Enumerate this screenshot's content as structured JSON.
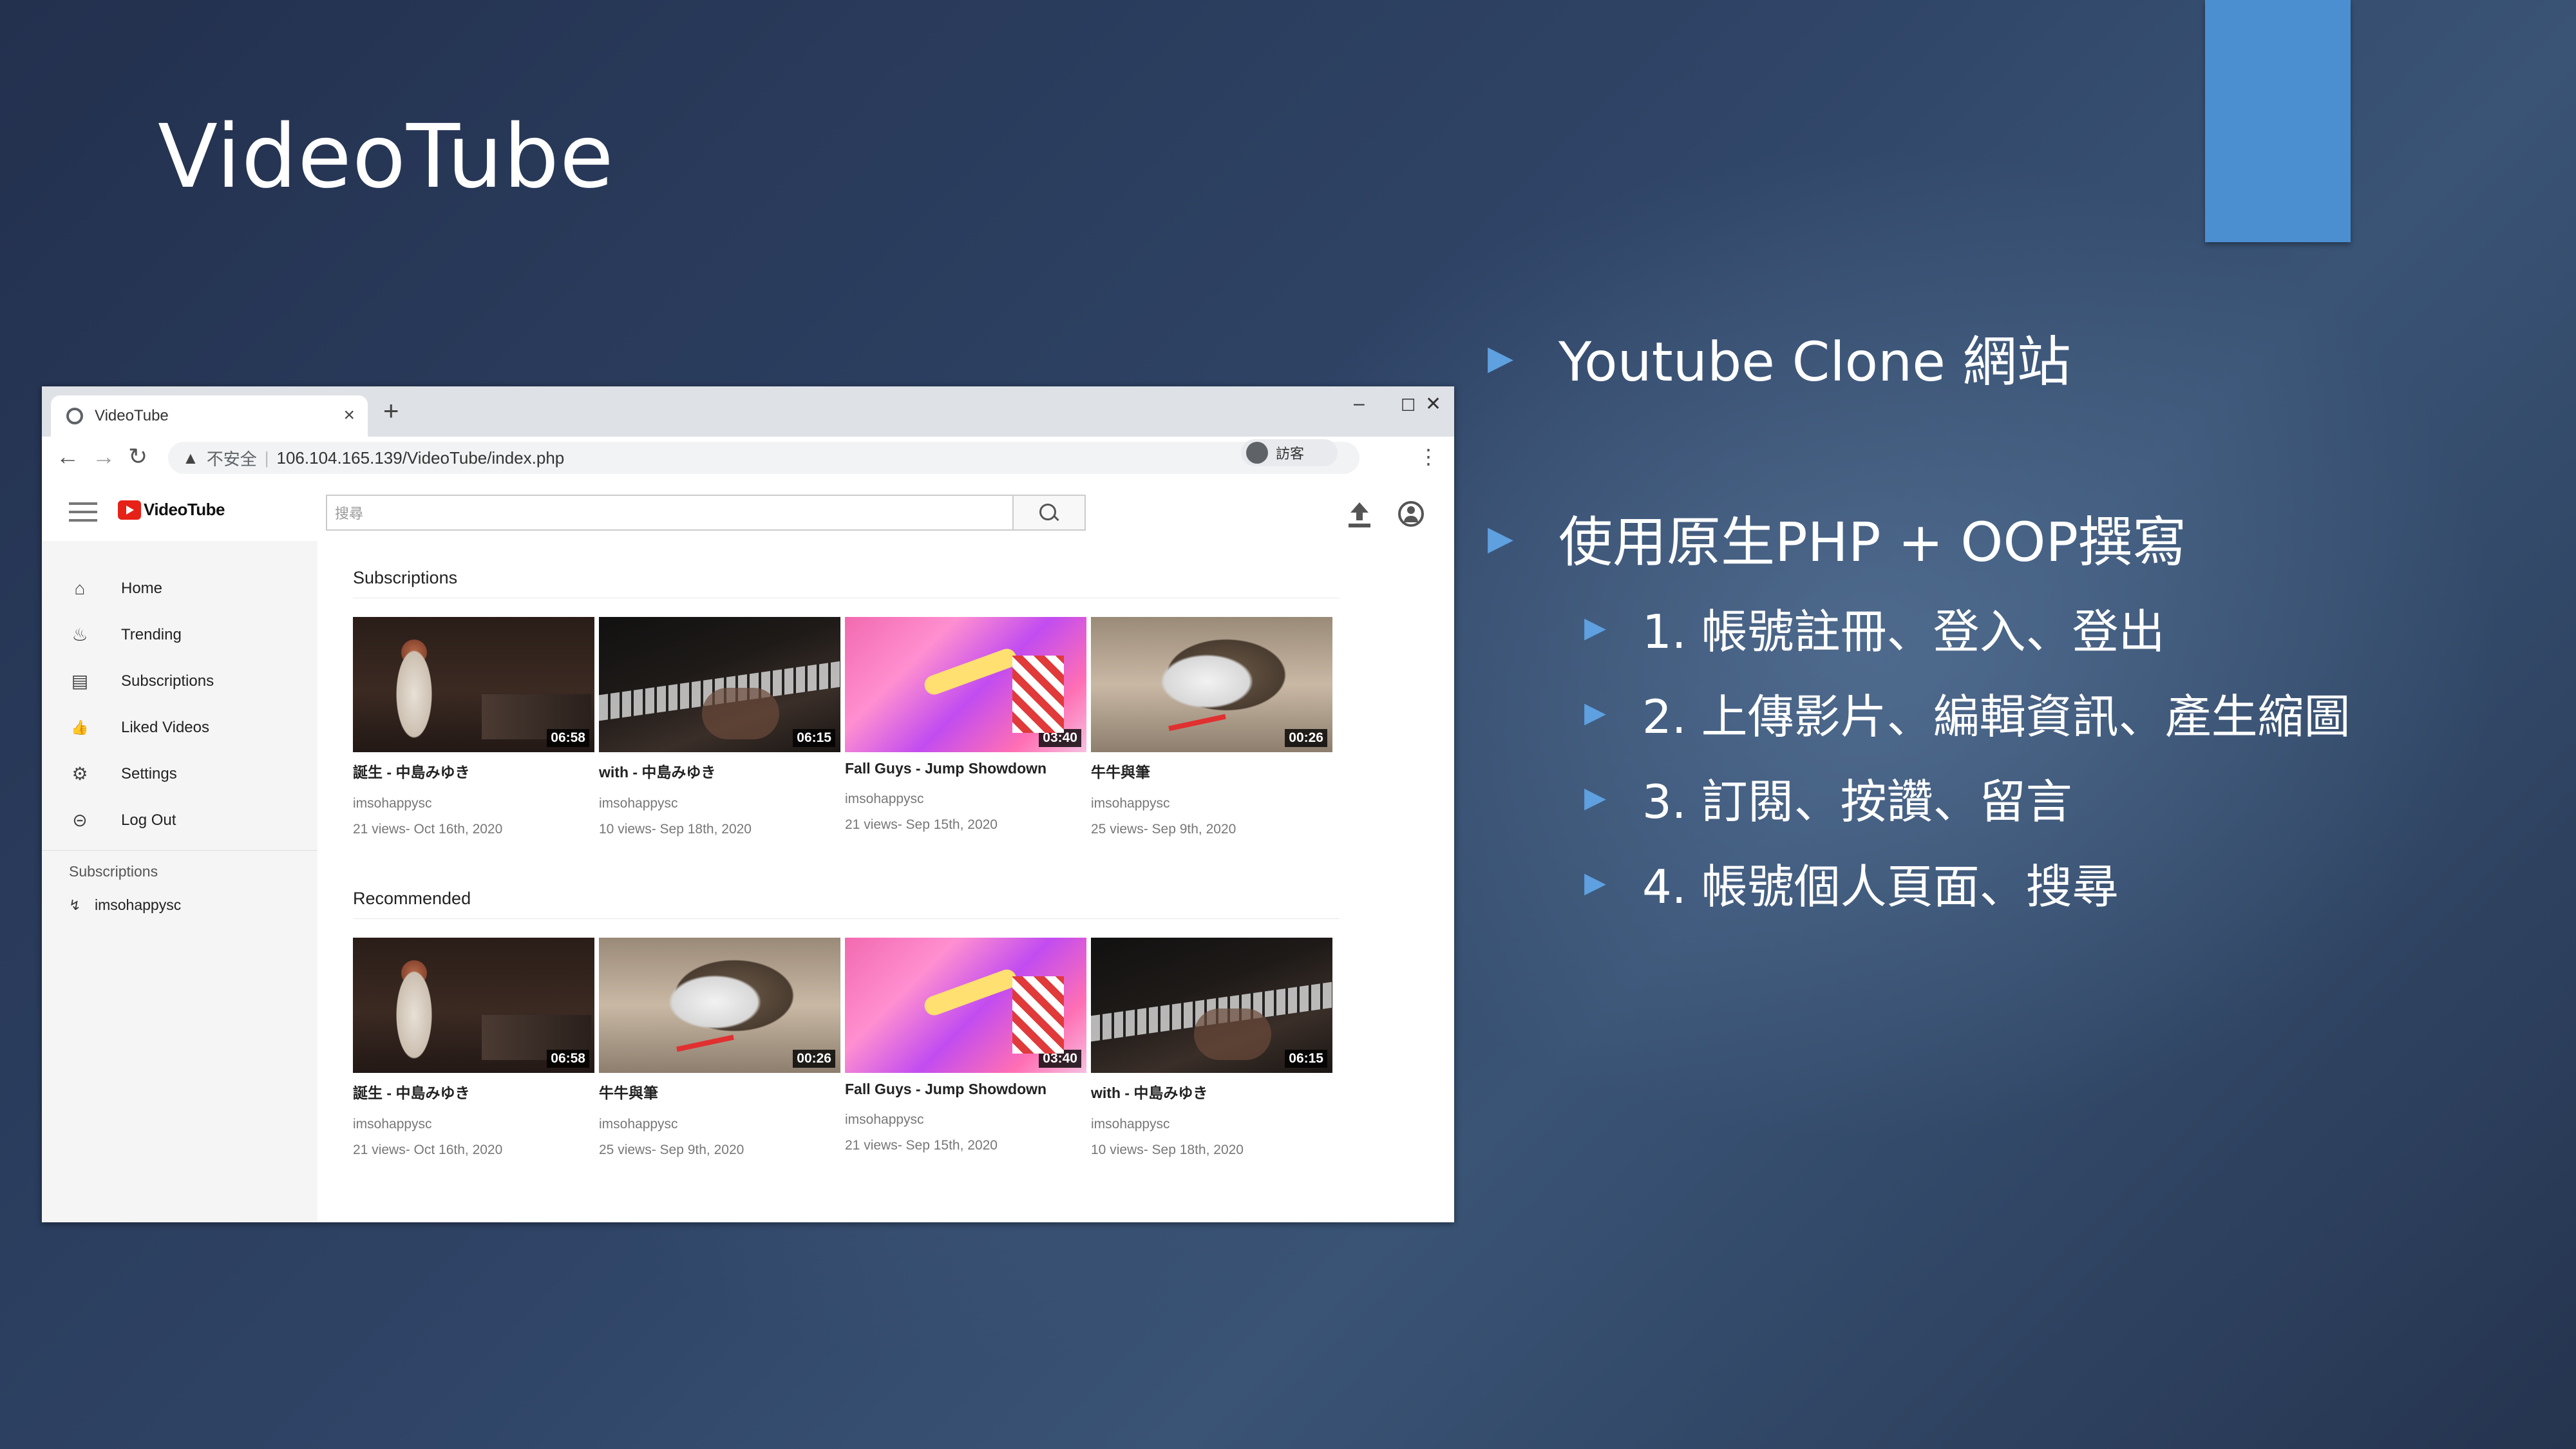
{
  "slide": {
    "title": "VideoTube",
    "bullets": [
      {
        "text": "Youtube Clone 網站"
      },
      {
        "text": "使用原生PHP + OOP撰寫"
      }
    ],
    "sub_bullets": [
      {
        "text": "1. 帳號註冊、登入、登出"
      },
      {
        "text": "2. 上傳影片、編輯資訊、產生縮圖"
      },
      {
        "text": "3. 訂閱、按讚、留言"
      },
      {
        "text": "4. 帳號個人頁面、搜尋"
      }
    ],
    "accent_color": "#4b8fd1"
  },
  "browser": {
    "tab_title": "VideoTube",
    "tab_close": "×",
    "new_tab": "+",
    "win_min": "–",
    "win_max": "☐",
    "win_close": "✕",
    "back": "←",
    "forward": "→",
    "reload": "↻",
    "warning": "▲",
    "insecure_label": "不安全",
    "separator": "|",
    "url": "106.104.165.139/VideoTube/index.php",
    "guest_label": "訪客",
    "menu": "⋮"
  },
  "app": {
    "logo_text": "VideoTube",
    "search_placeholder": "搜尋",
    "sidebar": [
      {
        "label": "Home",
        "icon": "home-icon",
        "glyph": "⌂"
      },
      {
        "label": "Trending",
        "icon": "fire-icon",
        "glyph": "♨"
      },
      {
        "label": "Subscriptions",
        "icon": "subscriptions-icon",
        "glyph": "▤"
      },
      {
        "label": "Liked Videos",
        "icon": "thumbs-up-icon",
        "glyph": "👍"
      },
      {
        "label": "Settings",
        "icon": "gear-icon",
        "glyph": "⚙"
      },
      {
        "label": "Log Out",
        "icon": "logout-icon",
        "glyph": "⊝"
      }
    ],
    "subscriptions_heading": "Subscriptions",
    "subscribed_channel": "imsohappysc",
    "subscribed_channel_glyph": "↯",
    "sections": [
      {
        "title": "Subscriptions",
        "videos": [
          {
            "title": "誕生 - 中島みゆき",
            "channel": "imsohappysc",
            "meta": "21 views- Oct 16th, 2020",
            "duration": "06:58",
            "thumb": "singer"
          },
          {
            "title": "with - 中島みゆき",
            "channel": "imsohappysc",
            "meta": "10 views- Sep 18th, 2020",
            "duration": "06:15",
            "thumb": "piano"
          },
          {
            "title": "Fall Guys - Jump Showdown",
            "channel": "imsohappysc",
            "meta": "21 views- Sep 15th, 2020",
            "duration": "03:40",
            "thumb": "game"
          },
          {
            "title": "牛牛與筆",
            "channel": "imsohappysc",
            "meta": "25 views- Sep 9th, 2020",
            "duration": "00:26",
            "thumb": "cat"
          }
        ]
      },
      {
        "title": "Recommended",
        "videos": [
          {
            "title": "誕生 - 中島みゆき",
            "channel": "imsohappysc",
            "meta": "21 views- Oct 16th, 2020",
            "duration": "06:58",
            "thumb": "singer"
          },
          {
            "title": "牛牛與筆",
            "channel": "imsohappysc",
            "meta": "25 views- Sep 9th, 2020",
            "duration": "00:26",
            "thumb": "cat"
          },
          {
            "title": "Fall Guys - Jump Showdown",
            "channel": "imsohappysc",
            "meta": "21 views- Sep 15th, 2020",
            "duration": "03:40",
            "thumb": "game"
          },
          {
            "title": "with - 中島みゆき",
            "channel": "imsohappysc",
            "meta": "10 views- Sep 18th, 2020",
            "duration": "06:15",
            "thumb": "piano"
          }
        ]
      }
    ]
  }
}
